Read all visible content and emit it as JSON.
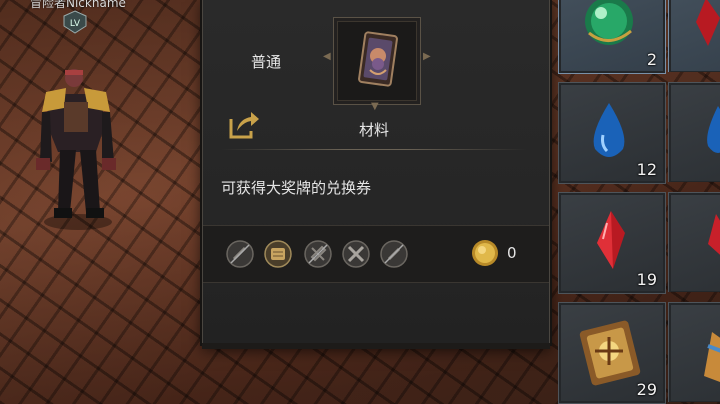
{
  "player": {
    "name": "冒险者Nickname",
    "level_badge": "LV"
  },
  "tooltip": {
    "grade": "普通",
    "item_type": "材料",
    "description": "可获得大奖牌的兑换券",
    "price": "0",
    "tag_icons": [
      "disabled-tag-icon",
      "scroll-tag-icon",
      "disabled-tool-icon",
      "cross-tools-icon",
      "disabled-sword-icon"
    ],
    "colors": {
      "panel": "#262626",
      "gold": "#c9a24a",
      "text": "#e6e6e6"
    }
  },
  "inventory": {
    "slots": [
      {
        "icon": "green-orb-icon",
        "count": "2"
      },
      {
        "icon": "blue-drop-icon",
        "count": "12"
      },
      {
        "icon": "red-crystal-icon",
        "count": "19"
      },
      {
        "icon": "scroll-icon",
        "count": "29"
      }
    ]
  }
}
